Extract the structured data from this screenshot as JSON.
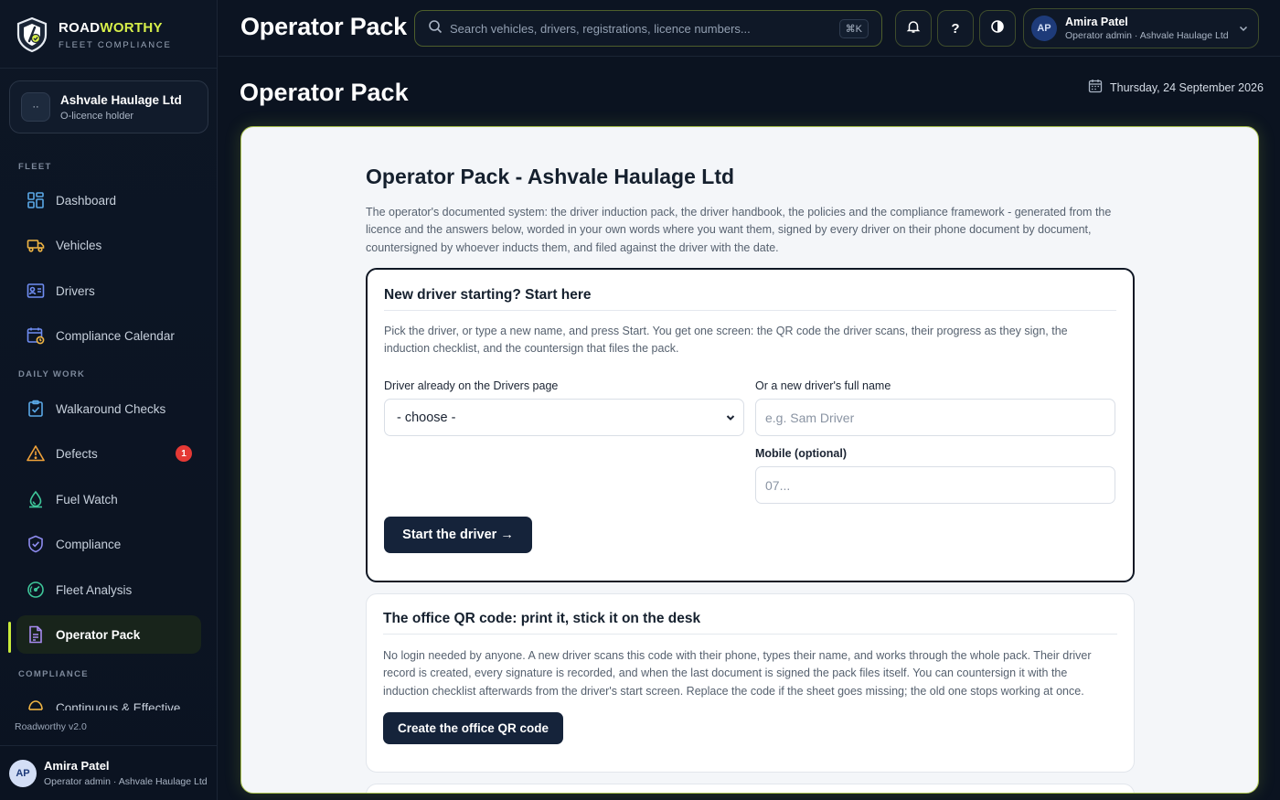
{
  "brand": {
    "name_main": "ROAD",
    "name_accent": "WORTHY",
    "subtitle": "FLEET COMPLIANCE",
    "version": "Roadworthy v2.0"
  },
  "org": {
    "initials": "··",
    "name": "Ashvale Haulage Ltd",
    "role": "O-licence holder"
  },
  "sidebar": {
    "sections": [
      "FLEET",
      "DAILY WORK",
      "COMPLIANCE"
    ],
    "items": [
      {
        "label": "Dashboard",
        "icon": "grid-icon"
      },
      {
        "label": "Vehicles",
        "icon": "truck-icon"
      },
      {
        "label": "Drivers",
        "icon": "id-card-icon"
      },
      {
        "label": "Compliance Calendar",
        "icon": "calendar-clock-icon"
      },
      {
        "label": "Walkaround Checks",
        "icon": "clipboard-check-icon"
      },
      {
        "label": "Defects",
        "icon": "warning-icon",
        "badge": "1"
      },
      {
        "label": "Fuel Watch",
        "icon": "fuel-drop-icon"
      },
      {
        "label": "Compliance",
        "icon": "shield-check-icon"
      },
      {
        "label": "Fleet Analysis",
        "icon": "gauge-icon"
      },
      {
        "label": "Operator Pack",
        "icon": "document-icon",
        "active": true
      },
      {
        "label": "Continuous & Effective",
        "icon": "cycle-icon"
      }
    ]
  },
  "user": {
    "initials": "AP",
    "name": "Amira Patel",
    "role": "Operator admin · Ashvale Haulage Ltd"
  },
  "topbar": {
    "title": "Operator Pack",
    "search_placeholder": "Search vehicles, drivers, registrations, licence numbers...",
    "shortcut": "⌘K",
    "help_label": "?"
  },
  "page": {
    "title": "Operator Pack",
    "date": "Thursday, 24 September 2026",
    "doc_title": "Operator Pack - Ashvale Haulage Ltd",
    "intro": "The operator's documented system: the driver induction pack, the driver handbook, the policies and the compliance framework - generated from the licence and the answers below, worded in your own words where you want them, signed by every driver on their phone document by document, countersigned by whoever inducts them, and filed against the driver with the date.",
    "new_driver": {
      "heading": "New driver starting? Start here",
      "desc": "Pick the driver, or type a new name, and press Start. You get one screen: the QR code the driver scans, their progress as they sign, the induction checklist, and the countersign that files the pack.",
      "existing_label": "Driver already on the Drivers page",
      "select_value": "- choose -",
      "new_name_label": "Or a new driver's full name",
      "new_name_placeholder": "e.g. Sam Driver",
      "mobile_label": "Mobile (optional)",
      "mobile_placeholder": "07...",
      "start_button": "Start the driver →"
    },
    "office_qr": {
      "heading": "The office QR code: print it, stick it on the desk",
      "desc": "No login needed by anyone. A new driver scans this code with their phone, types their name, and works through the whole pack. Their driver record is created, every signature is recorded, and when the last document is signed the pack files itself. You can countersign it with the induction checklist afterwards from the driver's start screen. Replace the code if the sheet goes missing; the old one stops working at once.",
      "button": "Create the office QR code"
    }
  },
  "colors": {
    "accent": "#d7ef4a",
    "badge": "#e53935",
    "button_dark": "#15233a"
  }
}
